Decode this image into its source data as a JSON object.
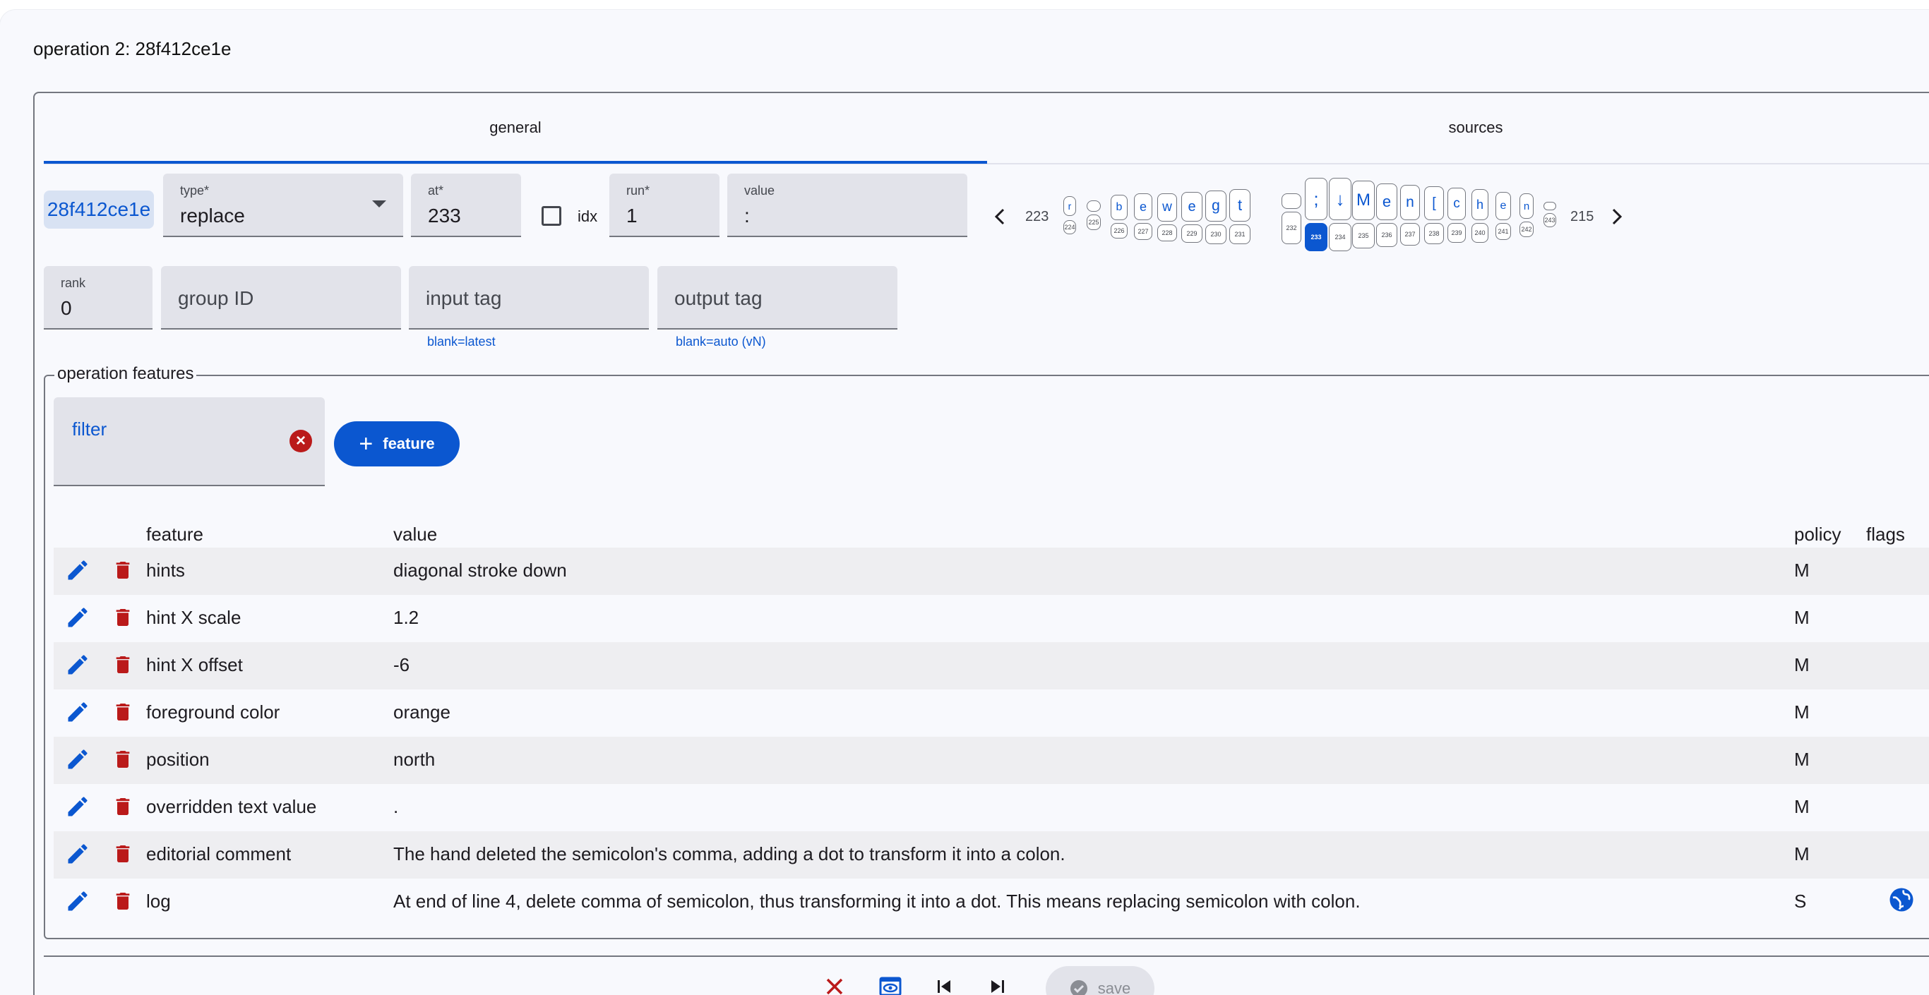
{
  "page_title": "operation 2: 28f412ce1e",
  "tabs": [
    {
      "label": "general"
    },
    {
      "label": "sources"
    }
  ],
  "op_id": "28f412ce1e",
  "type_field": {
    "label": "type*",
    "value": "replace"
  },
  "at_field": {
    "label": "at*",
    "value": "233"
  },
  "idx_label": "idx",
  "run_field": {
    "label": "run*",
    "value": "1"
  },
  "value_field": {
    "label": "value",
    "value": ":"
  },
  "rank_field": {
    "label": "rank",
    "value": "0"
  },
  "group_field": {
    "placeholder": "group ID"
  },
  "input_tag_field": {
    "placeholder": "input tag",
    "hint": "blank=latest"
  },
  "output_tag_field": {
    "placeholder": "output tag",
    "hint": "blank=auto (vN)"
  },
  "segments": {
    "left_number": "223",
    "right_number": "215",
    "top": [
      "r",
      "",
      "b",
      "e",
      "w",
      "e",
      "g",
      "t",
      "",
      ";",
      "↓",
      "M",
      "e",
      "n",
      "[",
      "c",
      "h",
      "e",
      "n",
      ""
    ],
    "bottom": [
      "224",
      "225",
      "226",
      "227",
      "228",
      "229",
      "230",
      "231",
      "232",
      "233",
      "234",
      "235",
      "236",
      "237",
      "238",
      "239",
      "240",
      "241",
      "242",
      "243"
    ],
    "selected": "233"
  },
  "features_section": {
    "legend": "operation features",
    "filter_value": "filter",
    "add_button_label": "feature"
  },
  "table": {
    "headers": {
      "feature": "feature",
      "value": "value",
      "policy": "policy",
      "flags": "flags"
    },
    "rows": [
      {
        "feature": "hints",
        "value": "diagonal stroke down",
        "policy": "M",
        "flag_icon": ""
      },
      {
        "feature": "hint X scale",
        "value": "1.2",
        "policy": "M",
        "flag_icon": ""
      },
      {
        "feature": "hint X offset",
        "value": "-6",
        "policy": "M",
        "flag_icon": ""
      },
      {
        "feature": "foreground color",
        "value": "orange",
        "policy": "M",
        "flag_icon": ""
      },
      {
        "feature": "position",
        "value": "north",
        "policy": "M",
        "flag_icon": ""
      },
      {
        "feature": "overridden text value",
        "value": ".",
        "policy": "M",
        "flag_icon": ""
      },
      {
        "feature": "editorial comment",
        "value": "The hand deleted the semicolon's comma, adding a dot to transform it into a colon.",
        "policy": "M",
        "flag_icon": ""
      },
      {
        "feature": "log",
        "value": "At end of line 4, delete comma of semicolon, thus transforming it into a dot. This means replacing semicolon with colon.",
        "policy": "S",
        "flag_icon": "globe-icon"
      }
    ]
  },
  "footer": {
    "save_label": "save"
  },
  "colors": {
    "accent": "#0b57d0",
    "danger": "#ba1a1a",
    "stripe": "#eeeef1"
  }
}
